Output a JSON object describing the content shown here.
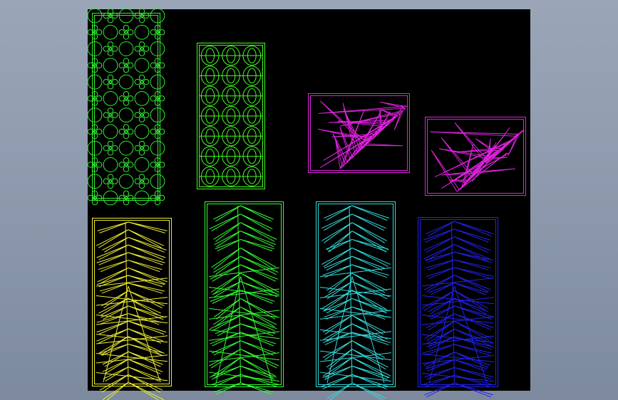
{
  "canvas": {
    "background": "#000000"
  },
  "panels": [
    {
      "id": "panel-1",
      "pattern": "circles-quatrefoil",
      "color": "#33ee33"
    },
    {
      "id": "panel-2",
      "pattern": "ovals-lattice",
      "color": "#44ff22"
    },
    {
      "id": "panel-3",
      "pattern": "leaf-diagonal",
      "color": "#dd22dd"
    },
    {
      "id": "panel-4",
      "pattern": "leaf-diagonal",
      "color": "#dd22dd"
    },
    {
      "id": "panel-5",
      "pattern": "leaf-fan",
      "color": "#eeee33"
    },
    {
      "id": "panel-6",
      "pattern": "leaf-fan",
      "color": "#33ff33"
    },
    {
      "id": "panel-7",
      "pattern": "leaf-fan",
      "color": "#33dddd"
    },
    {
      "id": "panel-8",
      "pattern": "leaf-fan",
      "color": "#2222ee"
    }
  ]
}
